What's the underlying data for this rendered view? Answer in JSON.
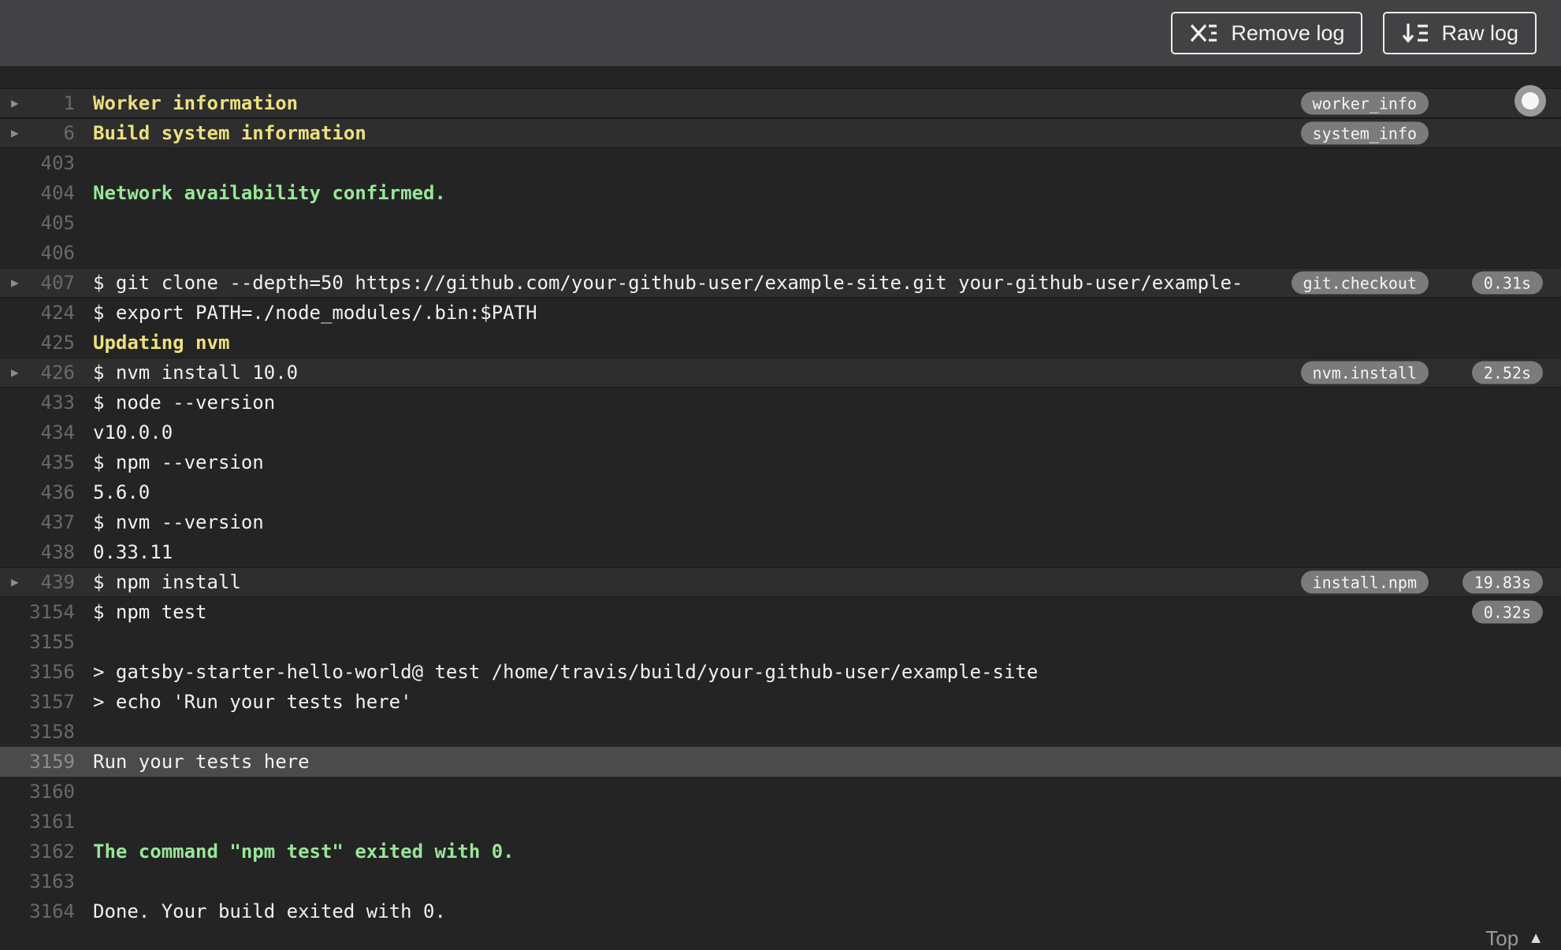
{
  "toolbar": {
    "remove_log": {
      "label": "Remove log",
      "icon": "remove-log-icon"
    },
    "raw_log": {
      "label": "Raw log",
      "icon": "raw-log-icon"
    }
  },
  "colors": {
    "toolbar_bg": "#424245",
    "log_bg": "#242424",
    "fold_row_bg": "#2e2e2e",
    "highlight_row_bg": "#4b4b4b",
    "text": "#f1f1f1",
    "yellow": "#ece07e",
    "green": "#99e699",
    "line_number": "#696969",
    "badge_bg": "#7b7b7b"
  },
  "log": {
    "lines": [
      {
        "num": "1",
        "text": "Worker information",
        "style": "yellow",
        "fold": true,
        "badge": "worker_info",
        "time": null,
        "highlight": false
      },
      {
        "num": "6",
        "text": "Build system information",
        "style": "yellow",
        "fold": true,
        "badge": "system_info",
        "time": null,
        "highlight": false
      },
      {
        "num": "403",
        "text": "",
        "style": null,
        "fold": false,
        "badge": null,
        "time": null,
        "highlight": false
      },
      {
        "num": "404",
        "text": "Network availability confirmed.",
        "style": "green",
        "fold": false,
        "badge": null,
        "time": null,
        "highlight": false
      },
      {
        "num": "405",
        "text": "",
        "style": null,
        "fold": false,
        "badge": null,
        "time": null,
        "highlight": false
      },
      {
        "num": "406",
        "text": "",
        "style": null,
        "fold": false,
        "badge": null,
        "time": null,
        "highlight": false
      },
      {
        "num": "407",
        "text": "$ git clone --depth=50 https://github.com/your-github-user/example-site.git your-github-user/example-",
        "style": null,
        "fold": true,
        "badge": "git.checkout",
        "time": "0.31s",
        "highlight": false
      },
      {
        "num": "424",
        "text": "$ export PATH=./node_modules/.bin:$PATH",
        "style": null,
        "fold": false,
        "badge": null,
        "time": null,
        "highlight": false
      },
      {
        "num": "425",
        "text": "Updating nvm",
        "style": "yellow",
        "fold": false,
        "badge": null,
        "time": null,
        "highlight": false
      },
      {
        "num": "426",
        "text": "$ nvm install 10.0",
        "style": null,
        "fold": true,
        "badge": "nvm.install",
        "time": "2.52s",
        "highlight": false
      },
      {
        "num": "433",
        "text": "$ node --version",
        "style": null,
        "fold": false,
        "badge": null,
        "time": null,
        "highlight": false
      },
      {
        "num": "434",
        "text": "v10.0.0",
        "style": null,
        "fold": false,
        "badge": null,
        "time": null,
        "highlight": false
      },
      {
        "num": "435",
        "text": "$ npm --version",
        "style": null,
        "fold": false,
        "badge": null,
        "time": null,
        "highlight": false
      },
      {
        "num": "436",
        "text": "5.6.0",
        "style": null,
        "fold": false,
        "badge": null,
        "time": null,
        "highlight": false
      },
      {
        "num": "437",
        "text": "$ nvm --version",
        "style": null,
        "fold": false,
        "badge": null,
        "time": null,
        "highlight": false
      },
      {
        "num": "438",
        "text": "0.33.11",
        "style": null,
        "fold": false,
        "badge": null,
        "time": null,
        "highlight": false
      },
      {
        "num": "439",
        "text": "$ npm install",
        "style": null,
        "fold": true,
        "badge": "install.npm",
        "time": "19.83s",
        "highlight": false
      },
      {
        "num": "3154",
        "text": "$ npm test",
        "style": null,
        "fold": false,
        "badge": null,
        "time": "0.32s",
        "highlight": false
      },
      {
        "num": "3155",
        "text": "",
        "style": null,
        "fold": false,
        "badge": null,
        "time": null,
        "highlight": false
      },
      {
        "num": "3156",
        "text": "> gatsby-starter-hello-world@ test /home/travis/build/your-github-user/example-site",
        "style": null,
        "fold": false,
        "badge": null,
        "time": null,
        "highlight": false
      },
      {
        "num": "3157",
        "text": "> echo 'Run your tests here'",
        "style": null,
        "fold": false,
        "badge": null,
        "time": null,
        "highlight": false
      },
      {
        "num": "3158",
        "text": "",
        "style": null,
        "fold": false,
        "badge": null,
        "time": null,
        "highlight": false
      },
      {
        "num": "3159",
        "text": "Run your tests here",
        "style": null,
        "fold": false,
        "badge": null,
        "time": null,
        "highlight": true
      },
      {
        "num": "3160",
        "text": "",
        "style": null,
        "fold": false,
        "badge": null,
        "time": null,
        "highlight": false
      },
      {
        "num": "3161",
        "text": "",
        "style": null,
        "fold": false,
        "badge": null,
        "time": null,
        "highlight": false
      },
      {
        "num": "3162",
        "text": "The command \"npm test\" exited with 0.",
        "style": "green",
        "fold": false,
        "badge": null,
        "time": null,
        "highlight": false
      },
      {
        "num": "3163",
        "text": "",
        "style": null,
        "fold": false,
        "badge": null,
        "time": null,
        "highlight": false
      },
      {
        "num": "3164",
        "text": "Done. Your build exited with 0.",
        "style": null,
        "fold": false,
        "badge": null,
        "time": null,
        "highlight": false
      }
    ]
  },
  "scroll_indicator": {
    "icon": "scroll-position-dot"
  },
  "footer": {
    "top_label": "Top",
    "icon": "caret-up-icon",
    "caret_glyph": "▲"
  },
  "glyphs": {
    "fold_caret": "▶"
  }
}
